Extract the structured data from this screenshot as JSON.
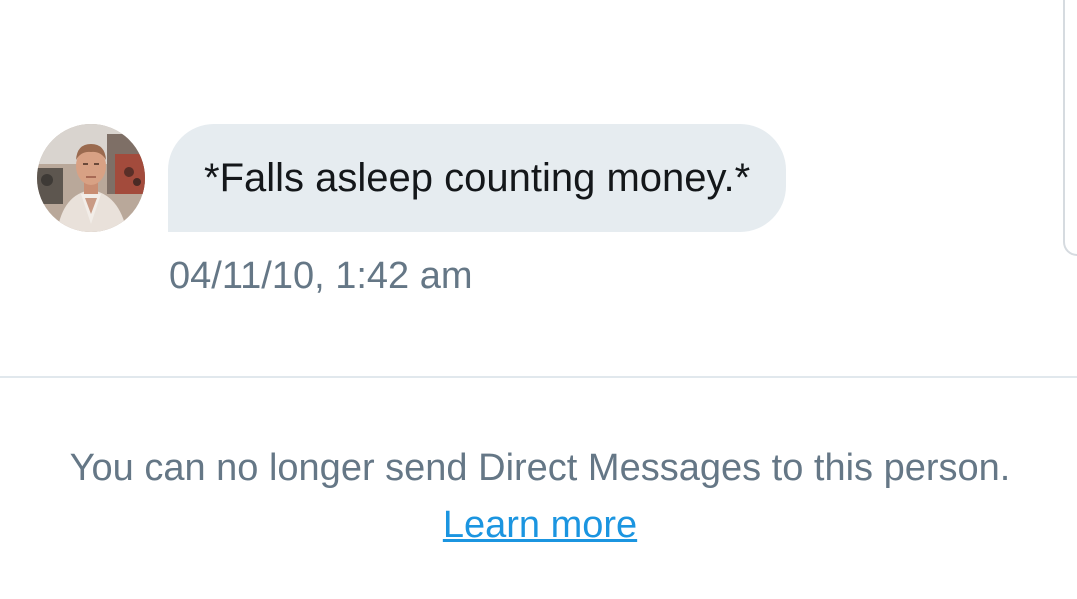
{
  "conversation": {
    "message": {
      "avatar_icon": "user-avatar-photo",
      "text": "*Falls asleep counting money.*",
      "timestamp": "04/11/10, 1:42 am"
    },
    "notice": {
      "text": "You can no longer send Direct Messages to this person.",
      "link_label": "Learn more"
    }
  },
  "colors": {
    "bubble_background": "#e6ecf0",
    "message_text": "#14171a",
    "secondary_text": "#657786",
    "link": "#1b95e0",
    "divider": "#e1e8ed"
  }
}
